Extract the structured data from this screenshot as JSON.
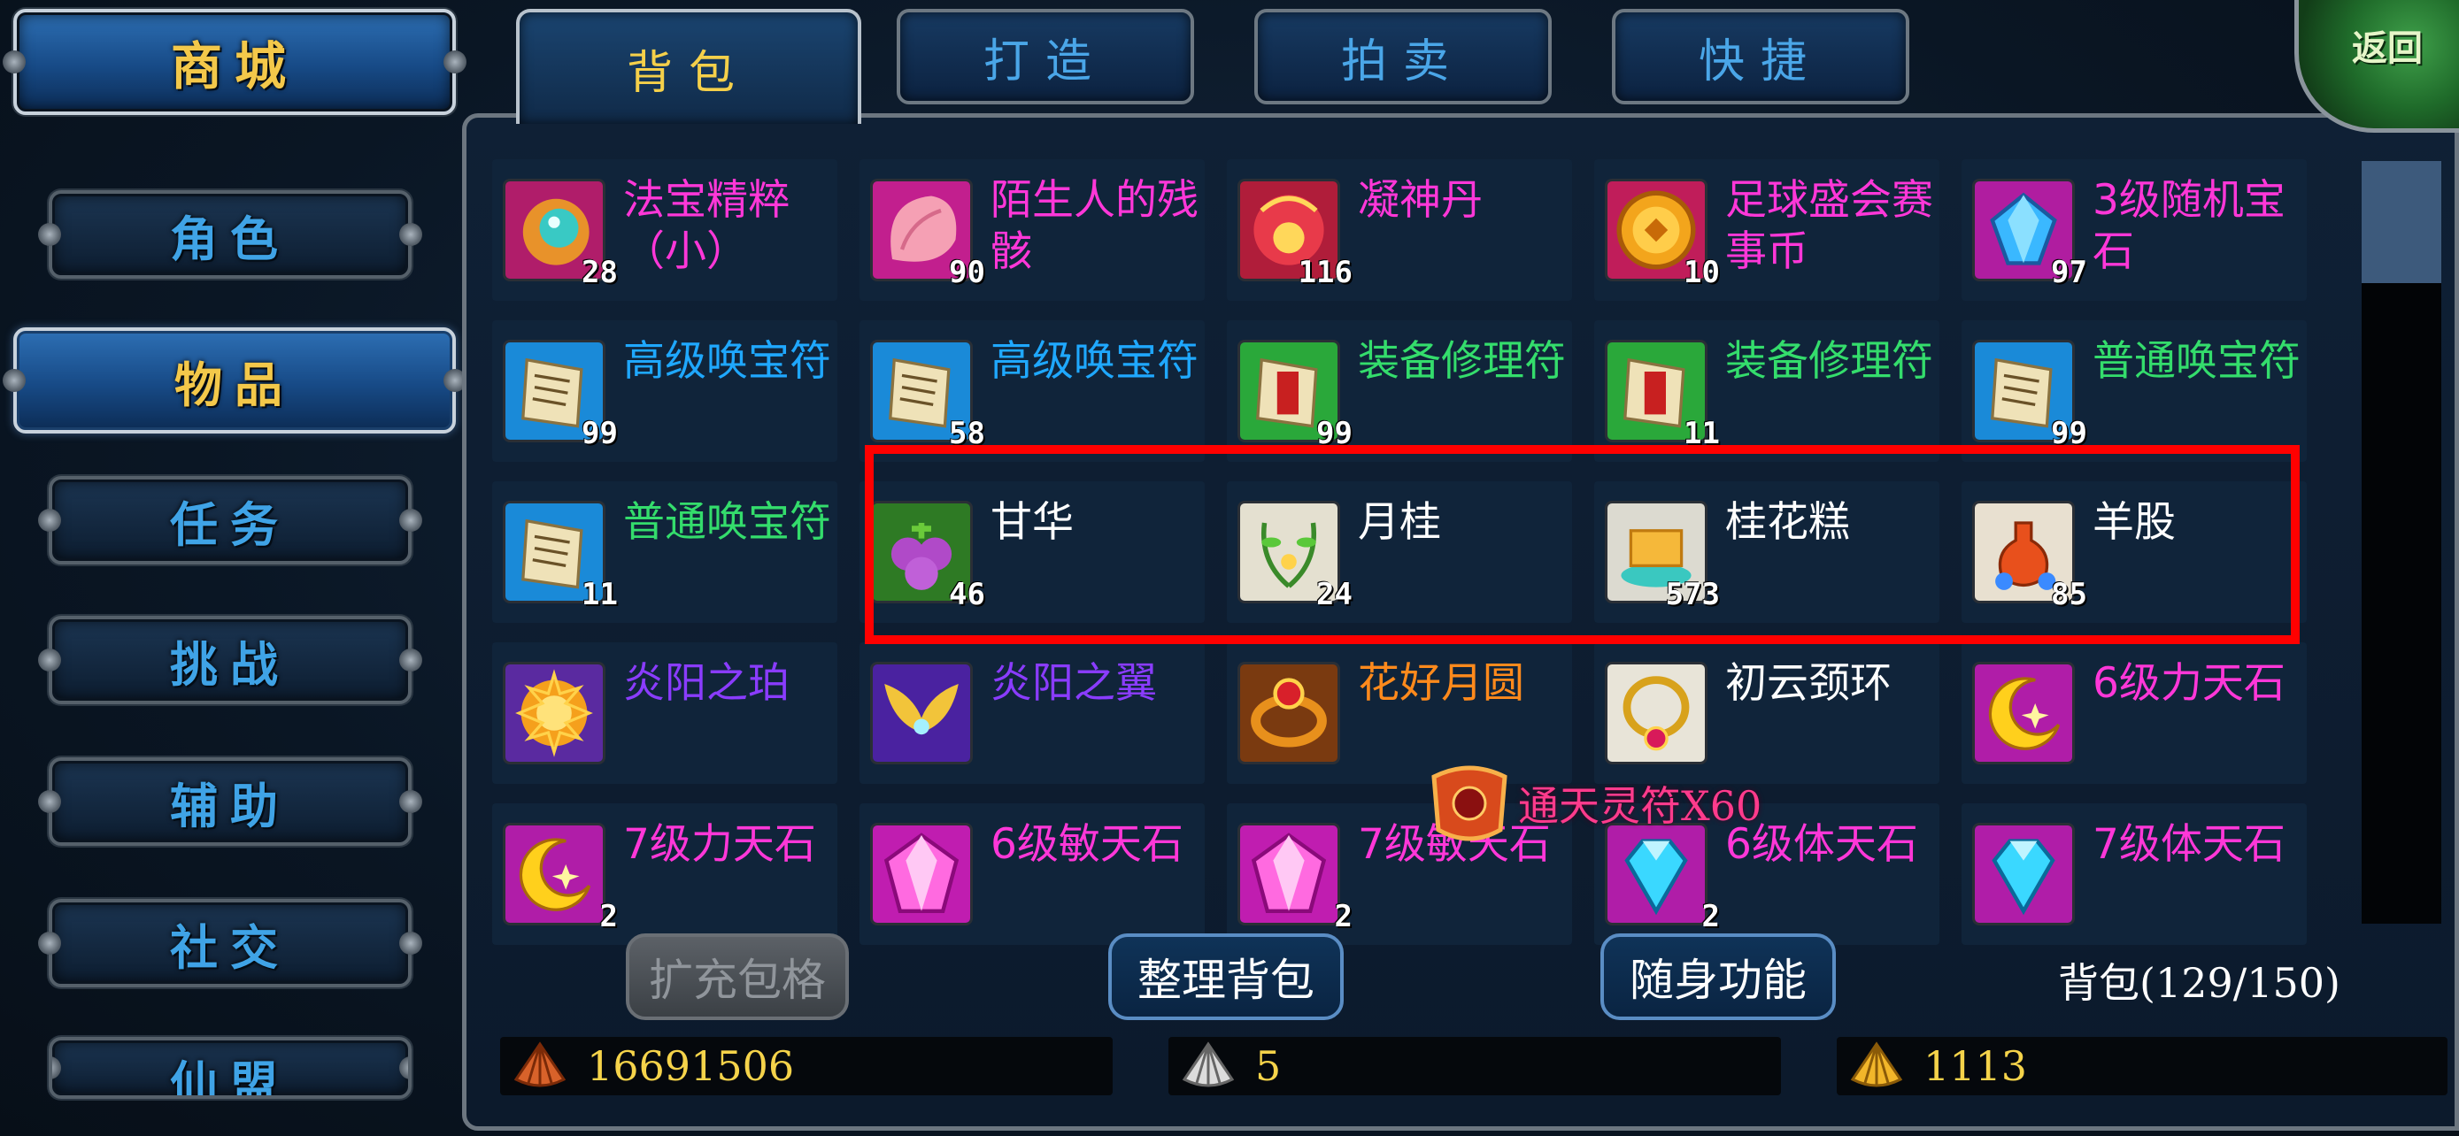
{
  "nav": {
    "mall": "商城",
    "items": [
      "角色",
      "物品",
      "任务",
      "挑战",
      "辅助",
      "社交",
      "仙盟"
    ]
  },
  "tabs": [
    "背包",
    "打造",
    "拍卖",
    "快捷"
  ],
  "back": "返回",
  "grid": [
    [
      {
        "name": "法宝精粹（小）",
        "count": "28",
        "color": "#ff37d8",
        "icon": "orb-icon"
      },
      {
        "name": "陌生人的残骸",
        "count": "90",
        "color": "#ff37d8",
        "icon": "shell-icon"
      },
      {
        "name": "凝神丹",
        "count": "116",
        "color": "#ff37d8",
        "icon": "pill-icon"
      },
      {
        "name": "足球盛会赛事币",
        "count": "10",
        "color": "#ff37d8",
        "icon": "coin-icon"
      },
      {
        "name": "3级随机宝石",
        "count": "97",
        "color": "#ff37d8",
        "icon": "gem-icon"
      }
    ],
    [
      {
        "name": "高级唤宝符",
        "count": "99",
        "color": "#1fa8ff",
        "icon": "scroll-icon"
      },
      {
        "name": "高级唤宝符",
        "count": "58",
        "color": "#1fa8ff",
        "icon": "scroll-icon"
      },
      {
        "name": "装备修理符",
        "count": "99",
        "color": "#34dd6c",
        "icon": "repair-scroll-icon"
      },
      {
        "name": "装备修理符",
        "count": "11",
        "color": "#34dd6c",
        "icon": "repair-scroll-icon"
      },
      {
        "name": "普通唤宝符",
        "count": "99",
        "color": "#34dd6c",
        "icon": "scroll-icon"
      }
    ],
    [
      {
        "name": "普通唤宝符",
        "count": "11",
        "color": "#34dd6c",
        "icon": "scroll-icon"
      },
      {
        "name": "甘华",
        "count": "46",
        "color": "#ffffff",
        "icon": "grape-icon"
      },
      {
        "name": "月桂",
        "count": "24",
        "color": "#ffffff",
        "icon": "laurel-icon"
      },
      {
        "name": "桂花糕",
        "count": "573",
        "color": "#ffffff",
        "icon": "cake-icon"
      },
      {
        "name": "羊股",
        "count": "85",
        "color": "#ffffff",
        "icon": "potion-icon"
      }
    ],
    [
      {
        "name": "炎阳之珀",
        "count": "",
        "color": "#8a3cff",
        "icon": "amber-icon"
      },
      {
        "name": "炎阳之翼",
        "count": "",
        "color": "#8a3cff",
        "icon": "wing-icon"
      },
      {
        "name": "花好月圆",
        "count": "",
        "color": "#ff8a1c",
        "icon": "ring-icon"
      },
      {
        "name": "初云颈环",
        "count": "",
        "color": "#ffffff",
        "icon": "necklace-icon"
      },
      {
        "name": "6级力天石",
        "count": "",
        "color": "#ff37d8",
        "icon": "moon-icon"
      }
    ],
    [
      {
        "name": "7级力天石",
        "count": "2",
        "color": "#ff37d8",
        "icon": "moon-icon"
      },
      {
        "name": "6级敏天石",
        "count": "",
        "color": "#ff37d8",
        "icon": "pink-gem-icon"
      },
      {
        "name": "7级敏天石",
        "count": "2",
        "color": "#ff37d8",
        "icon": "pink-gem-icon"
      },
      {
        "name": "6级体天石",
        "count": "2",
        "color": "#ff37d8",
        "icon": "diamond-icon"
      },
      {
        "name": "7级体天石",
        "count": "",
        "color": "#ff37d8",
        "icon": "diamond-icon"
      }
    ]
  ],
  "buttons": {
    "expand": "扩充包格",
    "sort": "整理背包",
    "portable": "随身功能"
  },
  "capacity": "背包(129/150)",
  "currency": [
    "16691506",
    "5",
    "1113"
  ],
  "reward": "通天灵符X60"
}
